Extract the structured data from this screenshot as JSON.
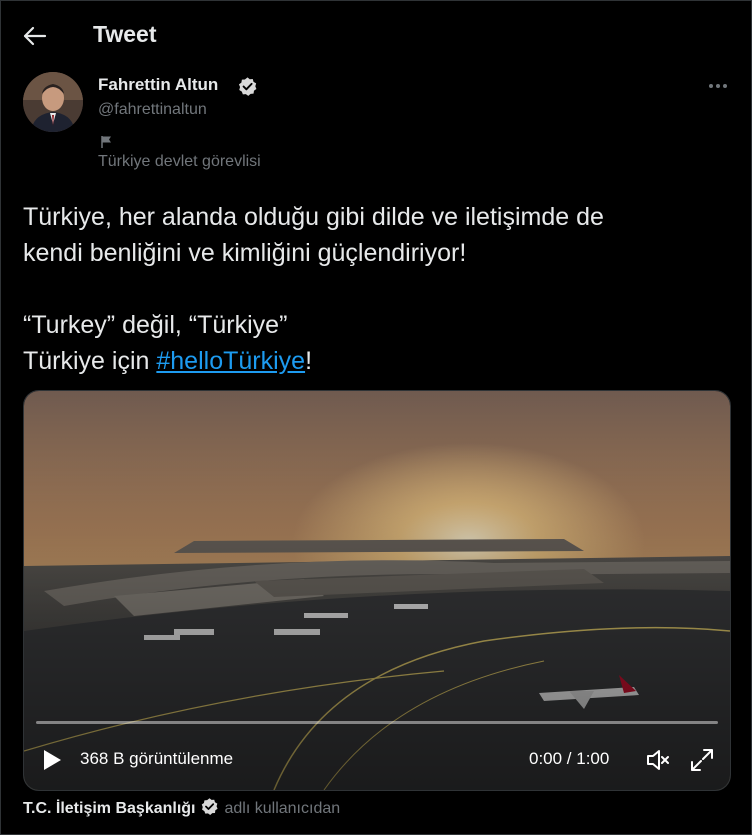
{
  "header": {
    "title": "Tweet",
    "back_icon": "arrow-left-icon"
  },
  "author": {
    "name": "Fahrettin Altun",
    "handle": "@fahrettinaltun",
    "verified": true,
    "label": "Türkiye devlet görevlisi",
    "label_icon": "flag-icon"
  },
  "tweet": {
    "line1": "Türkiye, her alanda olduğu gibi dilde ve iletişimde de",
    "line2": "kendi benliğini ve kimliğini güçlendiriyor!",
    "line3": "“Turkey” değil, “Türkiye”",
    "line4_prefix": "Türkiye için ",
    "hashtag": "#helloTürkiye",
    "line4_suffix": "!"
  },
  "video": {
    "views": "368 B görüntülenme",
    "time": "0:00 / 1:00",
    "progress": 0
  },
  "source": {
    "name": "T.C. İletişim Başkanlığı",
    "suffix": "adlı kullanıcıdan",
    "verified": true
  },
  "colors": {
    "background": "#000000",
    "text": "#e7e9ea",
    "muted": "#71767b",
    "link": "#1d9bf0",
    "verified": "#d9d9d9"
  }
}
